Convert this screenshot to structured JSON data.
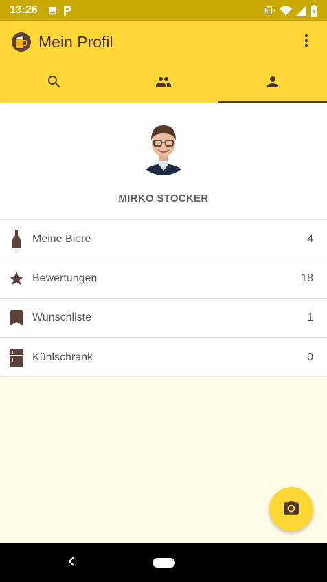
{
  "status_bar": {
    "time": "13:26",
    "left_icons": [
      "image-icon",
      "parking-icon"
    ],
    "right_icons": [
      "vibrate-icon",
      "wifi-icon",
      "signal-icon",
      "battery-icon"
    ]
  },
  "toolbar": {
    "title": "Mein Profil",
    "logo_icon": "beer-mug-icon",
    "overflow_icon": "more-vert-icon"
  },
  "tabs": [
    {
      "icon": "search-icon",
      "active": false
    },
    {
      "icon": "people-icon",
      "active": false
    },
    {
      "icon": "person-icon",
      "active": true
    }
  ],
  "profile": {
    "name": "MIRKO STOCKER",
    "avatar_icon": "avatar-photo"
  },
  "stats": [
    {
      "icon": "bottle-icon",
      "label": "Meine Biere",
      "count": "4"
    },
    {
      "icon": "star-icon",
      "label": "Bewertungen",
      "count": "18"
    },
    {
      "icon": "bookmark-icon",
      "label": "Wunschliste",
      "count": "1"
    },
    {
      "icon": "fridge-icon",
      "label": "Kühlschrank",
      "count": "0"
    }
  ],
  "fab": {
    "icon": "camera-icon"
  },
  "nav_bar": {
    "back_icon": "back-icon",
    "home_icon": "home-pill-icon"
  },
  "colors": {
    "status_bar": "#C9A802",
    "app_bar": "#FDD835",
    "brown": "#4E342E",
    "background": "#FFFDE7"
  }
}
